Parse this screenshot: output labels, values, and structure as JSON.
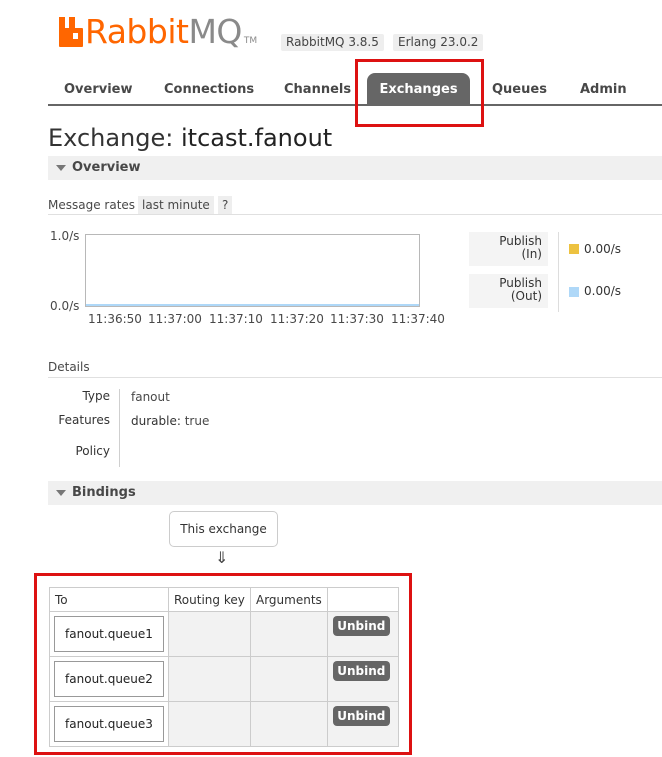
{
  "header": {
    "logo_rabbit": "Rabbit",
    "logo_mq": "MQ",
    "logo_tm": "TM",
    "rabbitmq_version": "RabbitMQ 3.8.5",
    "erlang_version": "Erlang 23.0.2"
  },
  "nav": {
    "tabs": [
      "Overview",
      "Connections",
      "Channels",
      "Exchanges",
      "Queues",
      "Admin"
    ],
    "active": "Exchanges"
  },
  "page": {
    "title_prefix": "Exchange:",
    "exchange_name": "itcast.fanout"
  },
  "overview": {
    "section_label": "Overview",
    "message_rates_label": "Message rates",
    "range_label": "last minute",
    "help_label": "?"
  },
  "chart_data": {
    "type": "line",
    "ylim": [
      0,
      1
    ],
    "y_ticks": [
      "1.0/s",
      "0.0/s"
    ],
    "x": [
      "11:36:50",
      "11:37:00",
      "11:37:10",
      "11:37:20",
      "11:37:30",
      "11:37:40"
    ],
    "series": [
      {
        "name": "Publish (In)",
        "values": [
          0,
          0,
          0,
          0,
          0,
          0
        ],
        "color": "#edc240",
        "current": "0.00/s"
      },
      {
        "name": "Publish (Out)",
        "values": [
          0,
          0,
          0,
          0,
          0,
          0
        ],
        "color": "#afd8f8",
        "current": "0.00/s"
      }
    ]
  },
  "legend": [
    {
      "line1": "Publish",
      "line2": "(In)",
      "value": "0.00/s",
      "color": "#edc240"
    },
    {
      "line1": "Publish",
      "line2": "(Out)",
      "value": "0.00/s",
      "color": "#afd8f8"
    }
  ],
  "details": {
    "label": "Details",
    "type_key": "Type",
    "type_value": "fanout",
    "features_key": "Features",
    "features_name": "durable:",
    "features_value": "true",
    "policy_key": "Policy",
    "policy_value": ""
  },
  "bindings": {
    "section_label": "Bindings",
    "this_exchange": "This exchange",
    "arrow": "⇓",
    "headers": [
      "To",
      "Routing key",
      "Arguments",
      ""
    ],
    "rows": [
      {
        "to": "fanout.queue1",
        "routing_key": "",
        "arguments": "",
        "action": "Unbind"
      },
      {
        "to": "fanout.queue2",
        "routing_key": "",
        "arguments": "",
        "action": "Unbind"
      },
      {
        "to": "fanout.queue3",
        "routing_key": "",
        "arguments": "",
        "action": "Unbind"
      }
    ]
  }
}
